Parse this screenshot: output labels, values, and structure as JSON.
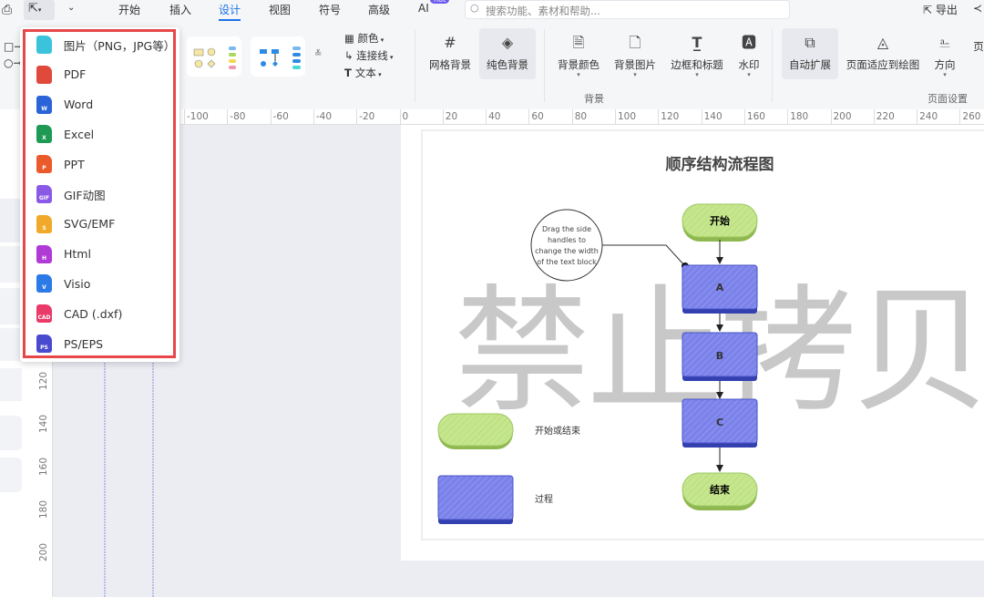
{
  "tabs": [
    "开始",
    "插入",
    "设计",
    "视图",
    "符号",
    "高级",
    "AI"
  ],
  "active_tab": "设计",
  "ai_badge": "hot",
  "search": {
    "placeholder": "搜索功能、素材和帮助..."
  },
  "export_label": "导出",
  "ribbon": {
    "style_options": [
      "颜色",
      "连接线",
      "文本"
    ],
    "background_buttons": [
      "网格背景",
      "纯色背景",
      "背景颜色",
      "背景图片",
      "边框和标题",
      "水印"
    ],
    "page_buttons": [
      "自动扩展",
      "页面适应到绘图",
      "方向",
      "页"
    ],
    "group_background": "背景",
    "group_page": "页面设置"
  },
  "hruler": [
    "-100",
    "-80",
    "-60",
    "-40",
    "-20",
    "0",
    "20",
    "40",
    "60",
    "80",
    "100",
    "120",
    "140",
    "160",
    "180",
    "200",
    "220",
    "240",
    "260"
  ],
  "vruler": [
    "120",
    "140",
    "160",
    "180",
    "200"
  ],
  "export_menu": [
    {
      "label": "图片（PNG，JPG等）",
      "color": "#3cc3dc",
      "tag": ""
    },
    {
      "label": "PDF",
      "color": "#e04a3a",
      "tag": ""
    },
    {
      "label": "Word",
      "color": "#2b64d8",
      "tag": "W"
    },
    {
      "label": "Excel",
      "color": "#1e9a55",
      "tag": "X"
    },
    {
      "label": "PPT",
      "color": "#ea5a2a",
      "tag": "P"
    },
    {
      "label": "GIF动图",
      "color": "#8a5ae6",
      "tag": "GIF"
    },
    {
      "label": "SVG/EMF",
      "color": "#f0a928",
      "tag": "S"
    },
    {
      "label": "Html",
      "color": "#b03ad6",
      "tag": "H"
    },
    {
      "label": "Visio",
      "color": "#2c7ae6",
      "tag": "V"
    },
    {
      "label": "CAD (.dxf)",
      "color": "#ea3a6a",
      "tag": "CAD"
    },
    {
      "label": "PS/EPS",
      "color": "#4a4ad0",
      "tag": "PS"
    }
  ],
  "diagram": {
    "title": "顺序结构流程图",
    "watermark": "禁止拷贝",
    "note_lines": [
      "Drag the side",
      "handles to",
      "change the width",
      "of the text block"
    ],
    "nodes": [
      "开始",
      "A",
      "B",
      "C",
      "结束"
    ],
    "legend": [
      "开始或结束",
      "过程"
    ]
  }
}
